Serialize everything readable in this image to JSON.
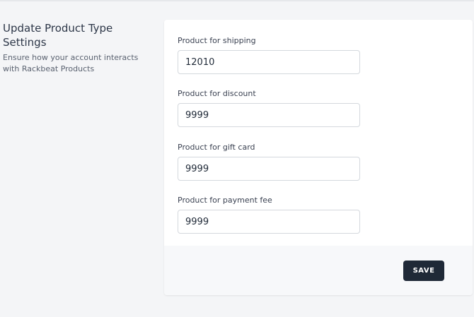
{
  "section": {
    "title": "Update Product Type Settings",
    "description": "Ensure how your account interacts with Rackbeat Products"
  },
  "form": {
    "fields": [
      {
        "label": "Product for shipping",
        "value": "12010"
      },
      {
        "label": "Product for discount",
        "value": "9999"
      },
      {
        "label": "Product for gift card",
        "value": "9999"
      },
      {
        "label": "Product for payment fee",
        "value": "9999"
      }
    ]
  },
  "footer": {
    "save_label": "SAVE"
  },
  "colors": {
    "background": "#f4f5f7",
    "card": "#ffffff",
    "button": "#1f2937",
    "input_border": "#d4d8dd"
  }
}
